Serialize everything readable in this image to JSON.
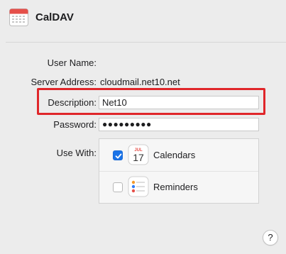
{
  "header": {
    "title": "CalDAV",
    "icon": "calendar-app-icon"
  },
  "form": {
    "user_name_label": "User Name:",
    "user_name_value": "",
    "server_address_label": "Server Address:",
    "server_address_value": "cloudmail.net10.net",
    "description_label": "Description:",
    "description_value": "Net10",
    "password_label": "Password:",
    "password_value": "●●●●●●●●●",
    "use_with_label": "Use With:"
  },
  "use_with": {
    "items": [
      {
        "label": "Calendars",
        "checked": true,
        "icon": "calendar-icon",
        "icon_month": "JUL",
        "icon_day": "17"
      },
      {
        "label": "Reminders",
        "checked": false,
        "icon": "reminders-icon"
      }
    ]
  },
  "help": {
    "label": "?"
  },
  "colors": {
    "highlight": "#e0262a",
    "checkbox_accent": "#1a73e8"
  }
}
